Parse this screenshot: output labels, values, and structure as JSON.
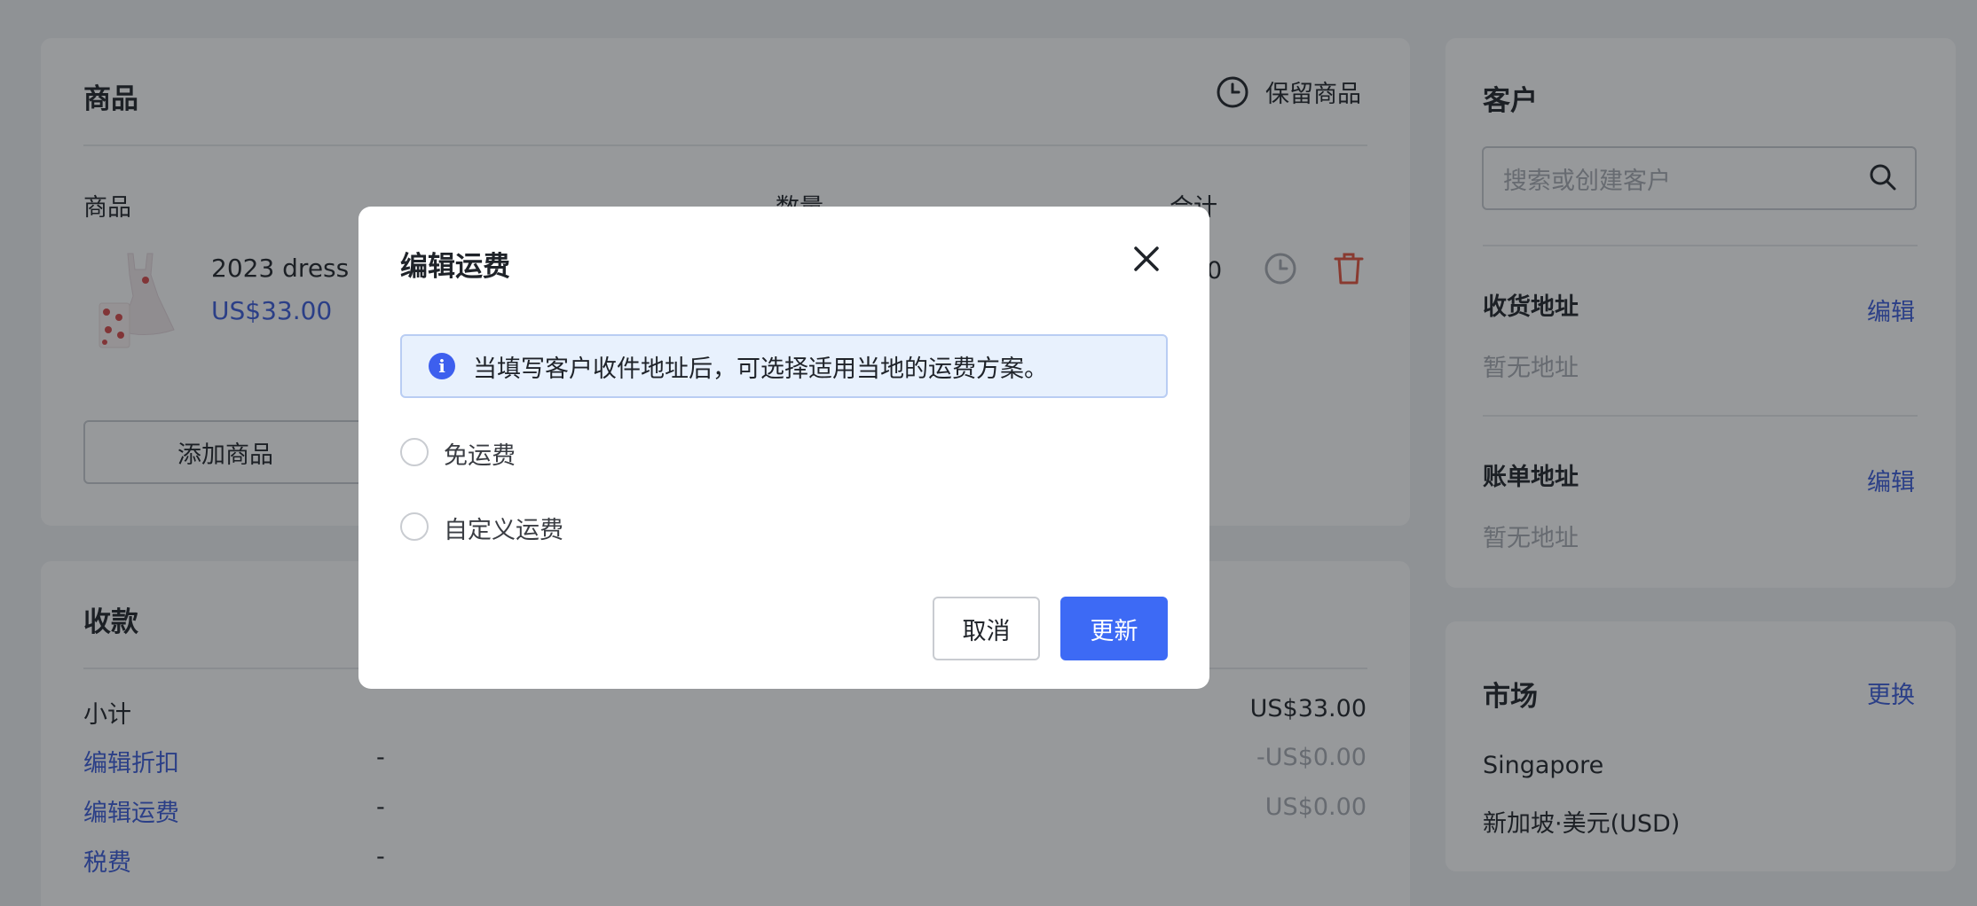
{
  "products": {
    "title": "商品",
    "hold_label": "保留商品",
    "col_product": "商品",
    "col_quantity": "数量",
    "col_total": "合计",
    "item": {
      "name": "2023 dress",
      "price": "US$33.00",
      "total_partial": "0"
    },
    "add_button": "添加商品"
  },
  "payment": {
    "title": "收款",
    "rows": [
      {
        "label": "小计",
        "mid": "",
        "value": "US$33.00"
      },
      {
        "label": "编辑折扣",
        "mid": "-",
        "value": "-US$0.00"
      },
      {
        "label": "编辑运费",
        "mid": "-",
        "value": "US$0.00"
      },
      {
        "label": "税费",
        "mid": "-",
        "value": ""
      }
    ]
  },
  "customer": {
    "title": "客户",
    "search_placeholder": "搜索或创建客户",
    "shipping_title": "收货地址",
    "shipping_edit": "编辑",
    "shipping_empty": "暂无地址",
    "billing_title": "账单地址",
    "billing_edit": "编辑",
    "billing_empty": "暂无地址"
  },
  "market": {
    "title": "市场",
    "change": "更换",
    "country": "Singapore",
    "currency": "新加坡·美元(USD)"
  },
  "modal": {
    "title": "编辑运费",
    "info": "当填写客户收件地址后，可选择适用当地的运费方案。",
    "options": [
      "免运费",
      "自定义运费"
    ],
    "cancel": "取消",
    "update": "更新"
  },
  "colors": {
    "primary": "#3d6af5",
    "link": "#3b5bdb",
    "danger": "#e5533d",
    "info_bg": "#e8f1fd"
  }
}
